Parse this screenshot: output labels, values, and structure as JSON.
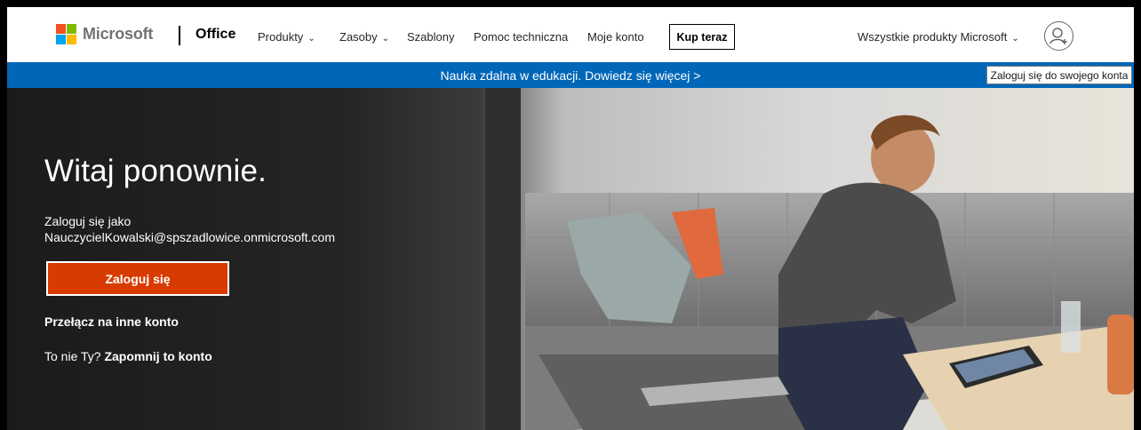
{
  "header": {
    "brand": "Microsoft",
    "product": "Office",
    "nav": [
      {
        "label": "Produkty",
        "dropdown": true
      },
      {
        "label": "Zasoby",
        "dropdown": true
      },
      {
        "label": "Szablony",
        "dropdown": false
      },
      {
        "label": "Pomoc techniczna",
        "dropdown": false
      },
      {
        "label": "Moje konto",
        "dropdown": false
      }
    ],
    "buy_label": "Kup teraz",
    "all_products_label": "Wszystkie produkty Microsoft",
    "account_icon": "account-add-icon"
  },
  "banner": {
    "text": "Nauka zdalna w edukacji. Dowiedz się więcej >",
    "tooltip": "Zaloguj się do swojego konta"
  },
  "hero": {
    "title": "Witaj ponownie.",
    "signin_as_label": "Zaloguj się jako",
    "email": "NauczycielKowalski@spszadlowice.onmicrosoft.com",
    "signin_button": "Zaloguj się",
    "switch_account": "Przełącz na inne konto",
    "not_you_prefix": "To nie Ty?",
    "forget_account": "Zapomnij to konto"
  },
  "colors": {
    "banner": "#0067b8",
    "signin_button": "#d83b01",
    "hero_dark": "#1b1b1b"
  }
}
